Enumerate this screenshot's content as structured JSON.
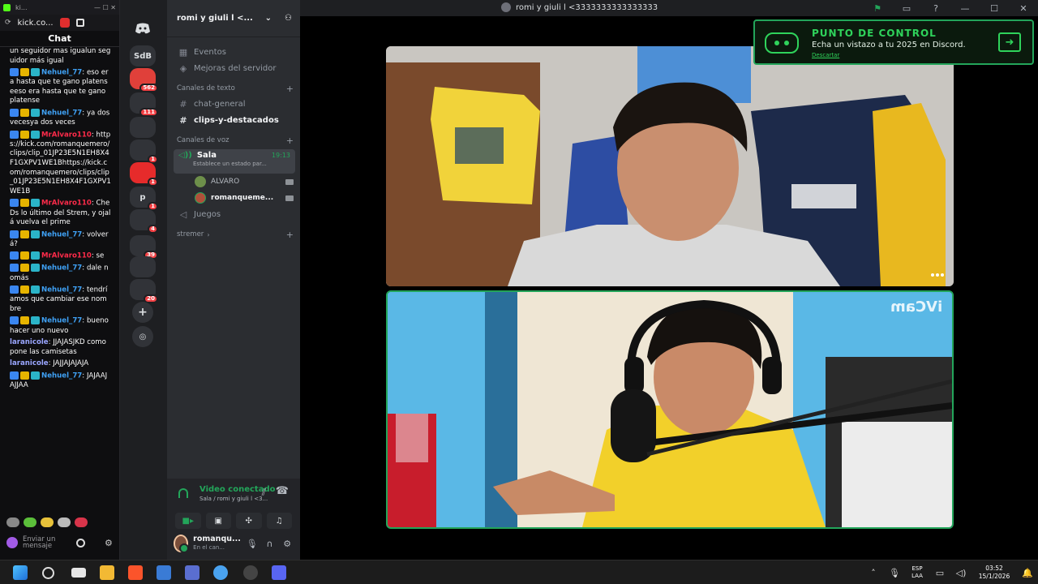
{
  "browser": {
    "tab_label": "kick.co...",
    "chat_title": "Chat",
    "input_placeholder": "Enviar un mensaje",
    "messages": [
      {
        "user": "",
        "text": "un seguidor mas igualun seguidor más igual",
        "color": "#ffffff",
        "badges": false
      },
      {
        "user": "Nehuel_77",
        "text": "eso era hasta que te gano platenseeso era hasta que te gano platense",
        "color": "#3fa1f5",
        "badges": true
      },
      {
        "user": "Nehuel_77",
        "text": "ya dos vecesya dos veces",
        "color": "#3fa1f5",
        "badges": true
      },
      {
        "user": "MrAlvaro110",
        "text": "https://kick.com/romanquemero/clips/clip_01JP23E5N1EH8X4F1GXPV1WE1Bhttps://kick.com/romanquemero/clips/clip_01JP23E5N1EH8X4F1GXPV1WE1B",
        "color": "#ff2b4a",
        "badges": true
      },
      {
        "user": "MrAlvaro110",
        "text": "Che Ds lo último del Strem, y ojalá vuelva el prime",
        "color": "#ff2b4a",
        "badges": true
      },
      {
        "user": "Nehuel_77",
        "text": "volverá?",
        "color": "#3fa1f5",
        "badges": true
      },
      {
        "user": "MrAlvaro110",
        "text": "se",
        "color": "#ff2b4a",
        "badges": true
      },
      {
        "user": "Nehuel_77",
        "text": "dale nomás",
        "color": "#3fa1f5",
        "badges": true
      },
      {
        "user": "Nehuel_77",
        "text": "tendríamos que cambiar ese nombre",
        "color": "#3fa1f5",
        "badges": true
      },
      {
        "user": "Nehuel_77",
        "text": "bueno hacer uno nuevo",
        "color": "#3fa1f5",
        "badges": true
      },
      {
        "user": "laranicole",
        "text": "JJAJASJKD como pone las camisetas",
        "color": "#9aa6ff",
        "badges": false
      },
      {
        "user": "laranicole",
        "text": "JAJJAJAJAJA",
        "color": "#9aa6ff",
        "badges": false
      },
      {
        "user": "Nehuel_77",
        "text": "JAJAAJAJJAA",
        "color": "#3fa1f5",
        "badges": true
      }
    ]
  },
  "rail": {
    "servers": [
      {
        "label": "SdB",
        "badge": ""
      },
      {
        "label": "",
        "badge": "562",
        "color": "#e0403a"
      },
      {
        "label": "",
        "badge": "111"
      },
      {
        "label": "",
        "badge": ""
      },
      {
        "label": "",
        "badge": "1"
      },
      {
        "label": "",
        "badge": "1",
        "color": "#e62b2b"
      },
      {
        "label": "p",
        "badge": "1"
      },
      {
        "label": "",
        "badge": "4"
      },
      {
        "label": "",
        "badge": "39"
      },
      {
        "label": "",
        "badge": ""
      },
      {
        "label": "",
        "badge": "20"
      }
    ]
  },
  "server": {
    "name": "romi y giuli l <...",
    "events": "Eventos",
    "boost": "Mejoras del servidor",
    "text_category": "Canales de texto",
    "text_channels": [
      "chat-general",
      "clips-y-destacados"
    ],
    "voice_category": "Canales de voz",
    "voice_channel": "Sala",
    "voice_time": "19:13",
    "voice_status": "Establece un estado par...",
    "voice_users": [
      {
        "name": "ALVARO",
        "bold": false
      },
      {
        "name": "romanqueme...",
        "bold": true
      }
    ],
    "other_voice": "Juegos",
    "stremer_category": "stremer"
  },
  "voice_panel": {
    "title": "Video conectado",
    "subtitle": "Sala / romi y giuli l <3...",
    "user_name": "romanqu...",
    "user_status": "En el can..."
  },
  "window": {
    "title": "romi y giuli l <3333333333333333"
  },
  "notice": {
    "title": "PUNTO DE CONTROL",
    "text": "Echa un vistazo a tu 2025 en Discord.",
    "dismiss": "Descartar"
  },
  "stage": {
    "tile2_watermark": "iVCam"
  },
  "taskbar": {
    "lang_line1": "ESP",
    "lang_line2": "LAA",
    "time": "03:52",
    "date": "15/1/2026"
  }
}
